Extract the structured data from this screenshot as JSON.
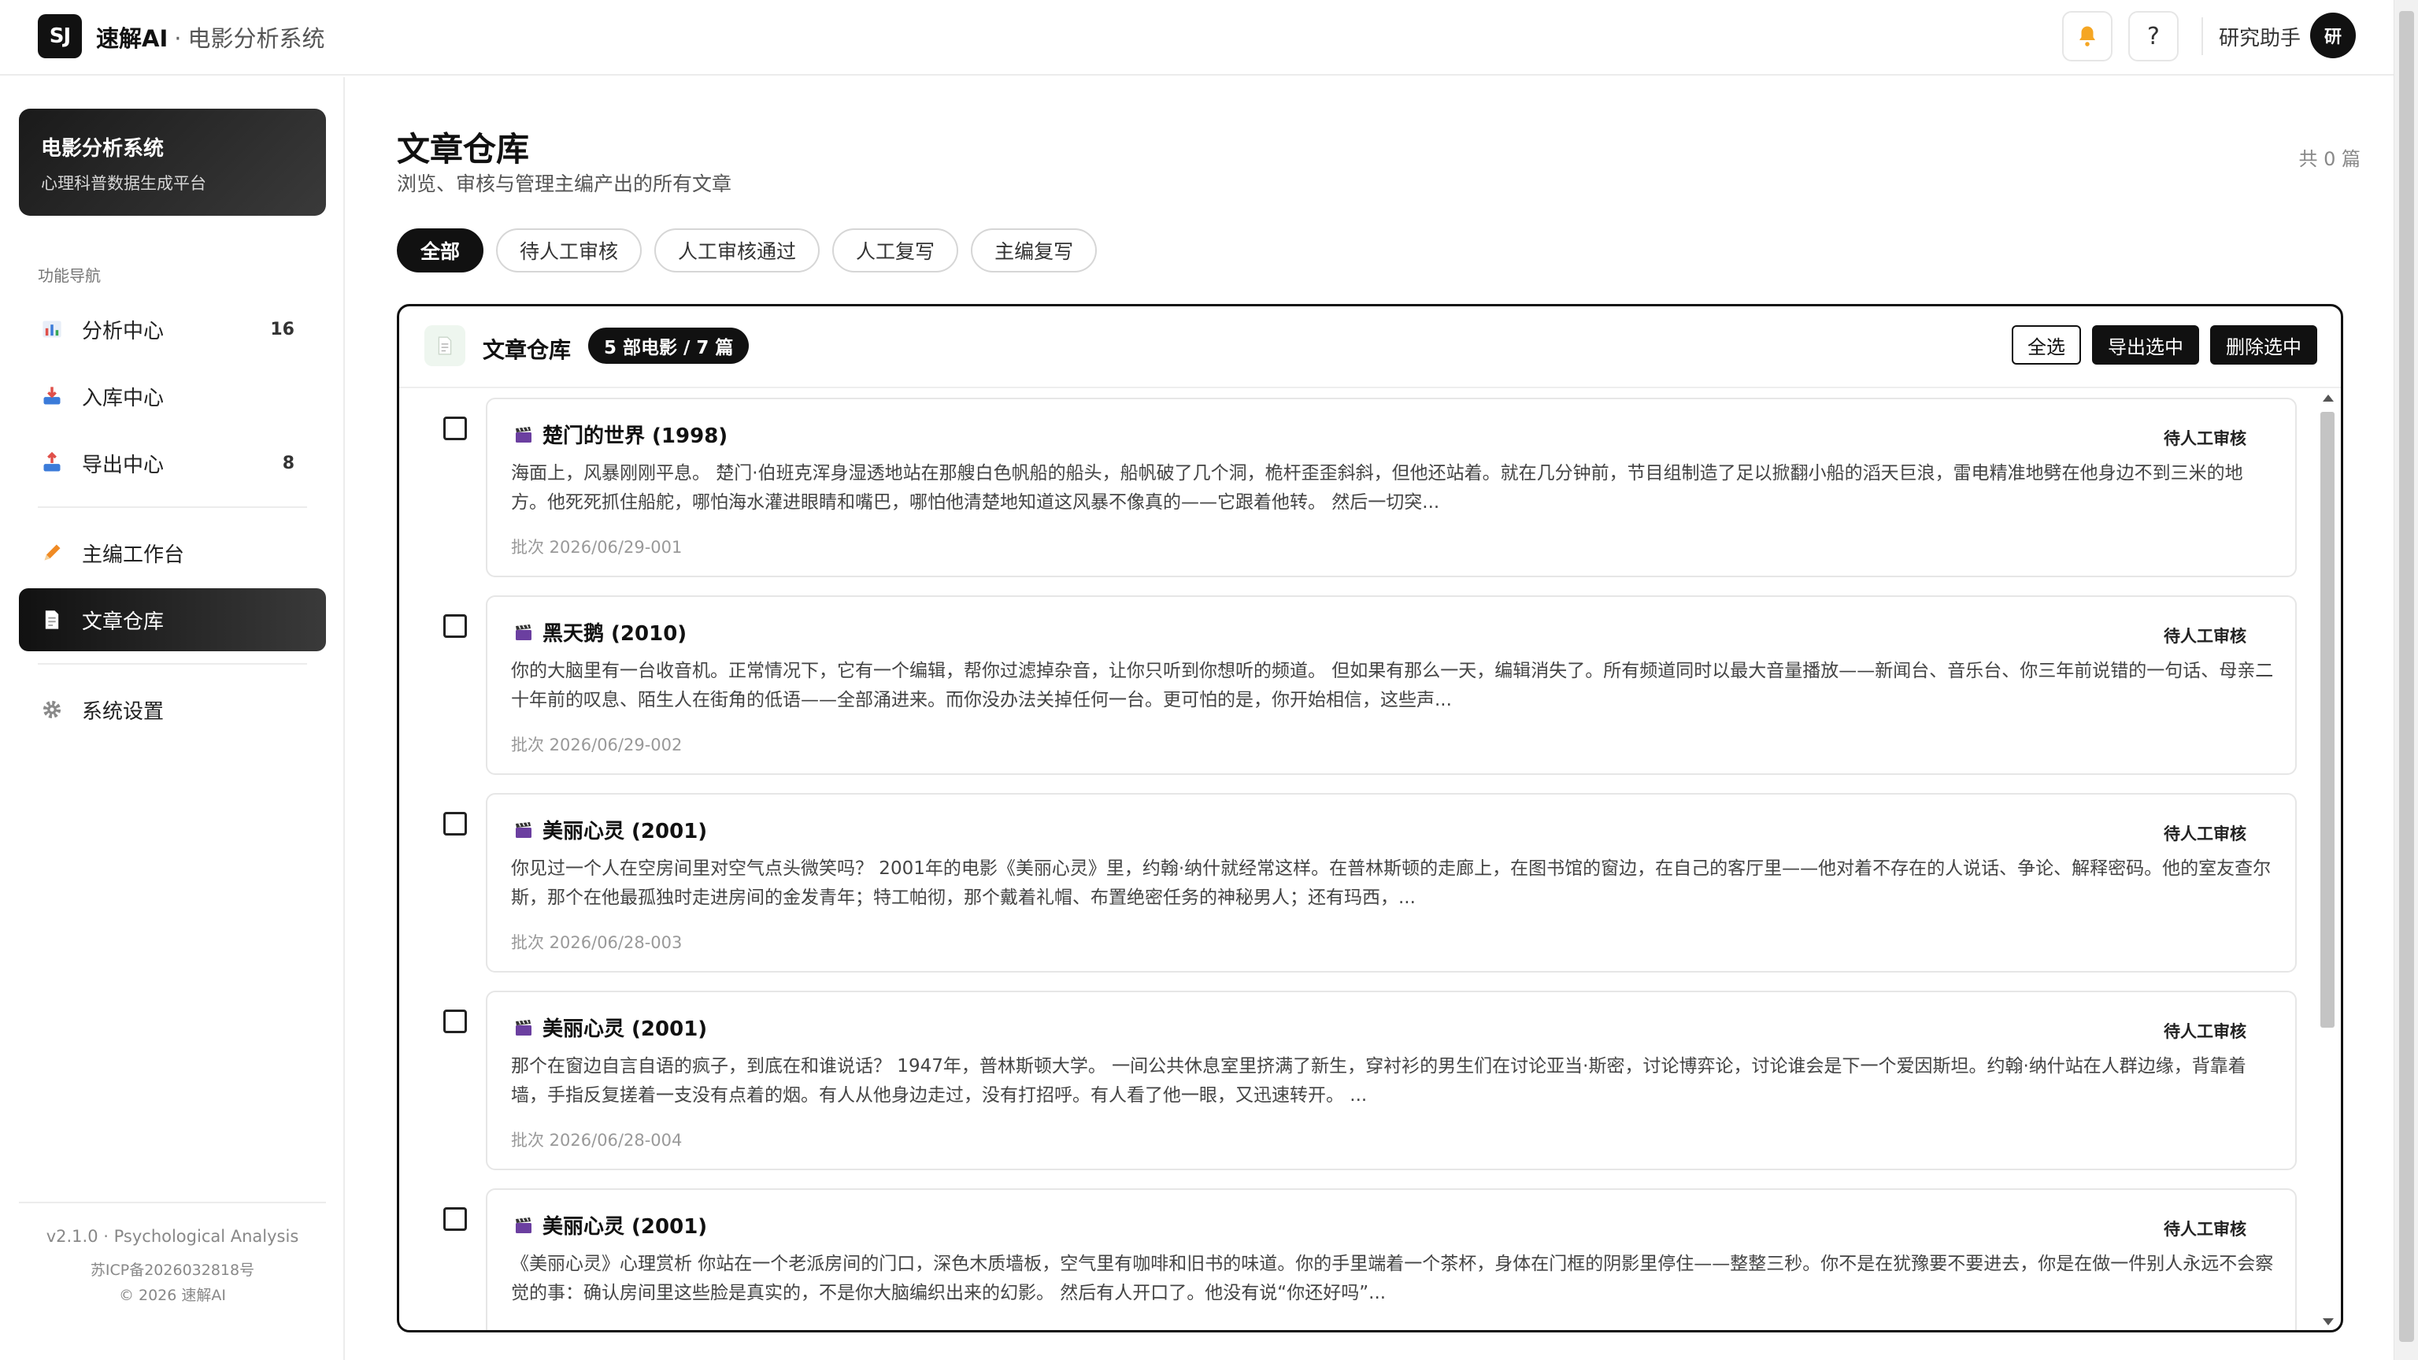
{
  "header": {
    "logo": "SJ",
    "brand": "速解AI",
    "separator": "·",
    "subtitle": "电影分析系统",
    "help": "?",
    "user_label": "研究助手",
    "avatar": "研"
  },
  "sidebar": {
    "card_title": "电影分析系统",
    "card_subtitle": "心理科普数据生成平台",
    "section_label": "功能导航",
    "items": [
      {
        "label": "分析中心",
        "badge": "16",
        "icon": "bar-chart-icon"
      },
      {
        "label": "入库中心",
        "badge": "",
        "icon": "inbox-icon"
      },
      {
        "label": "导出中心",
        "badge": "8",
        "icon": "export-icon"
      },
      {
        "label": "主编工作台",
        "badge": "",
        "icon": "pencil-icon"
      },
      {
        "label": "文章仓库",
        "badge": "",
        "icon": "document-icon",
        "active": true
      },
      {
        "label": "系统设置",
        "badge": "",
        "icon": "gear-icon"
      }
    ],
    "footer": {
      "version": "v2.1.0 · Psychological Analysis",
      "icp": "苏ICP备2026032818号",
      "copyright": "© 2026 速解AI"
    }
  },
  "main": {
    "title": "文章仓库",
    "subtitle": "浏览、审核与管理主编产出的所有文章",
    "total": "共 0 篇",
    "tabs": [
      "全部",
      "待人工审核",
      "人工审核通过",
      "人工复写",
      "主编复写"
    ],
    "panel": {
      "title": "文章仓库",
      "badge": "5 部电影 / 7 篇",
      "select_all": "全选",
      "export_selected": "导出选中",
      "delete_selected": "删除选中"
    },
    "articles": [
      {
        "title": "楚门的世界 (1998)",
        "status": "待人工审核",
        "excerpt": "海面上，风暴刚刚平息。 楚门·伯班克浑身湿透地站在那艘白色帆船的船头，船帆破了几个洞，桅杆歪歪斜斜，但他还站着。就在几分钟前，节目组制造了足以掀翻小船的滔天巨浪，雷电精准地劈在他身边不到三米的地方。他死死抓住船舵，哪怕海水灌进眼睛和嘴巴，哪怕他清楚地知道这风暴不像真的——它跟着他转。 然后一切突...",
        "batch": "批次 2026/06/29-001"
      },
      {
        "title": "黑天鹅 (2010)",
        "status": "待人工审核",
        "excerpt": "你的大脑里有一台收音机。正常情况下，它有一个编辑，帮你过滤掉杂音，让你只听到你想听的频道。 但如果有那么一天，编辑消失了。所有频道同时以最大音量播放——新闻台、音乐台、你三年前说错的一句话、母亲二十年前的叹息、陌生人在街角的低语——全部涌进来。而你没办法关掉任何一台。更可怕的是，你开始相信，这些声...",
        "batch": "批次 2026/06/29-002"
      },
      {
        "title": "美丽心灵 (2001)",
        "status": "待人工审核",
        "excerpt": "你见过一个人在空房间里对空气点头微笑吗？ 2001年的电影《美丽心灵》里，约翰·纳什就经常这样。在普林斯顿的走廊上，在图书馆的窗边，在自己的客厅里——他对着不存在的人说话、争论、解释密码。他的室友查尔斯，那个在他最孤独时走进房间的金发青年；特工帕彻，那个戴着礼帽、布置绝密任务的神秘男人；还有玛西，...",
        "batch": "批次 2026/06/28-003"
      },
      {
        "title": "美丽心灵 (2001)",
        "status": "待人工审核",
        "excerpt": "那个在窗边自言自语的疯子，到底在和谁说话？ 1947年，普林斯顿大学。 一间公共休息室里挤满了新生，穿衬衫的男生们在讨论亚当·斯密，讨论博弈论，讨论谁会是下一个爱因斯坦。约翰·纳什站在人群边缘，背靠着墙，手指反复搓着一支没有点着的烟。有人从他身边走过，没有打招呼。有人看了他一眼，又迅速转开。 ...",
        "batch": "批次 2026/06/28-004"
      },
      {
        "title": "美丽心灵 (2001)",
        "status": "待人工审核",
        "excerpt": "《美丽心灵》心理赏析 你站在一个老派房间的门口，深色木质墙板，空气里有咖啡和旧书的味道。你的手里端着一个茶杯，身体在门框的阴影里停住——整整三秒。你不是在犹豫要不要进去，你是在做一件别人永远不会察觉的事：确认房间里这些脸是真实的，不是你大脑编织出来的幻影。 然后有人开口了。他没有说“你还好吗”...",
        "batch": ""
      }
    ]
  },
  "colors": {
    "primary": "#111111",
    "bell": "#f5a623",
    "active_nav": "#111111"
  }
}
